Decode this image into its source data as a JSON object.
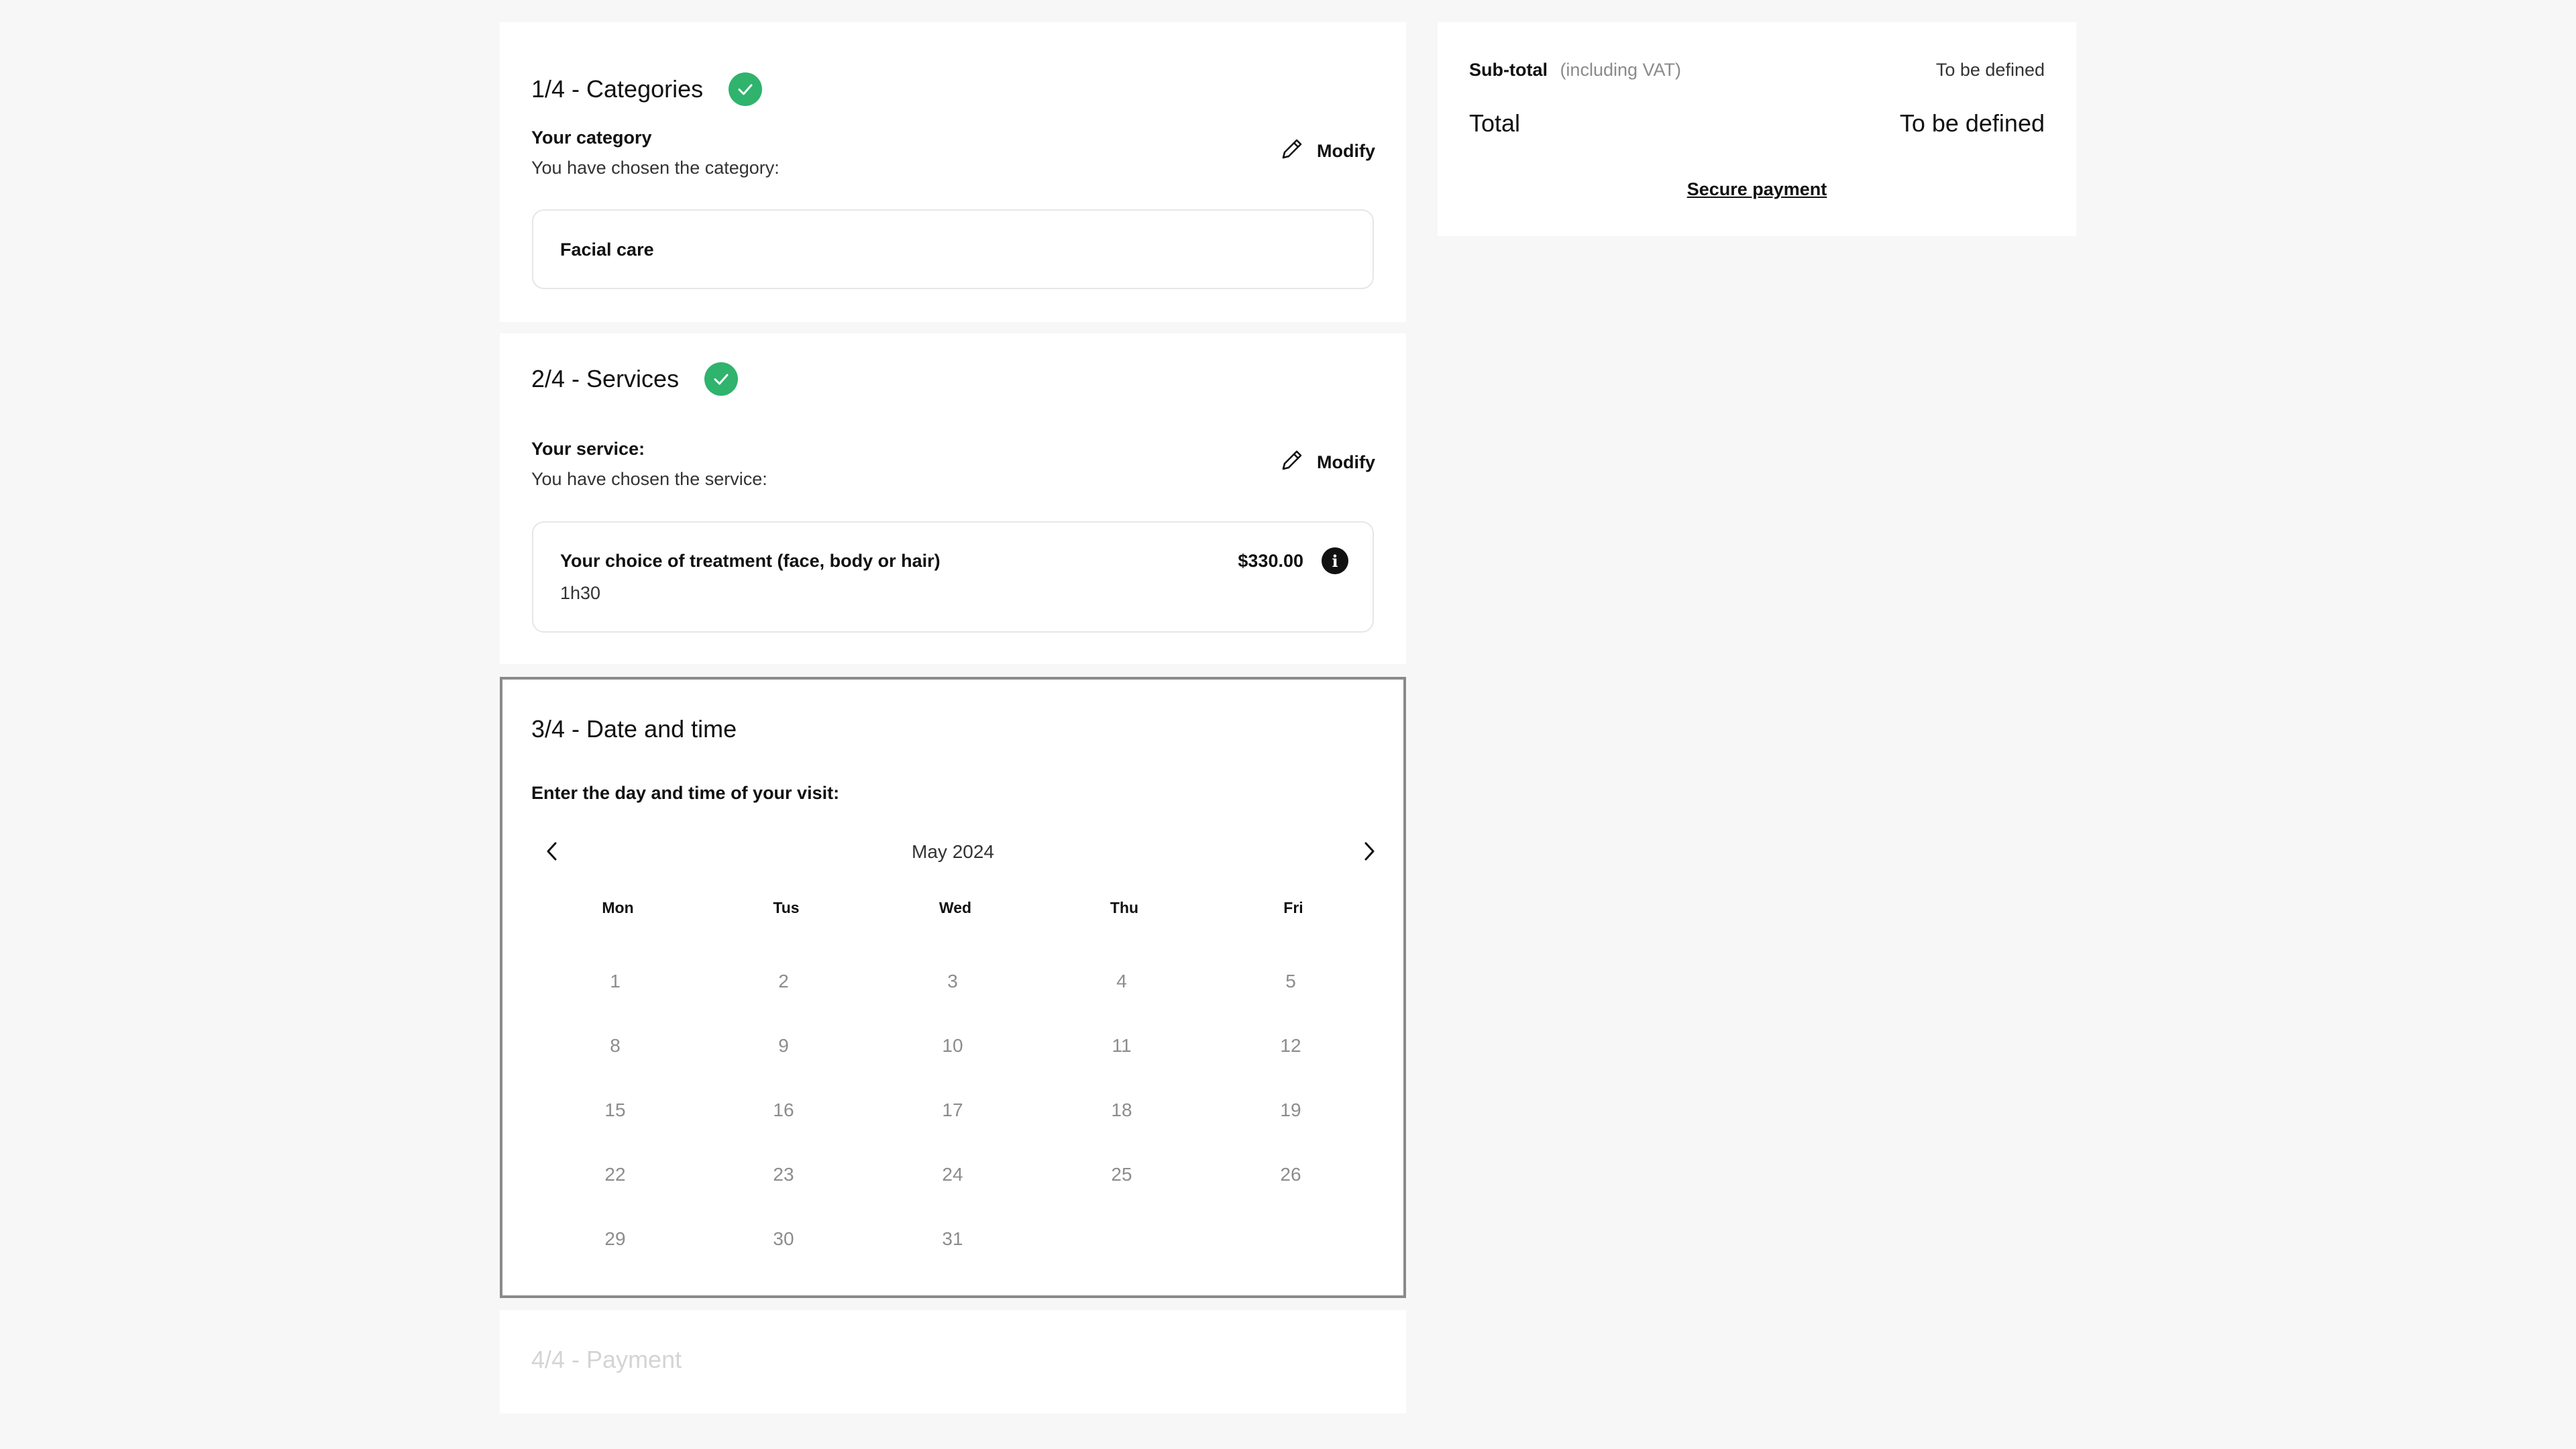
{
  "steps": {
    "categories": {
      "title": "1/4 - Categories",
      "subhead": "Your category",
      "subtext": "You have chosen the category:",
      "modify_label": "Modify",
      "selection": "Facial care"
    },
    "services": {
      "title": "2/4 - Services",
      "subhead": "Your service:",
      "subtext": "You have chosen the service:",
      "modify_label": "Modify",
      "selection": {
        "name": "Your choice of treatment (face, body or hair)",
        "duration": "1h30",
        "price": "$330.00"
      }
    },
    "datetime": {
      "title": "3/4 - Date and time",
      "instruction": "Enter the day and time of your visit:",
      "calendar": {
        "month": "May 2024",
        "weekdays": [
          "Mon",
          "Tus",
          "Wed",
          "Thu",
          "Fri"
        ],
        "weeks": [
          [
            "1",
            "2",
            "3",
            "4",
            "5"
          ],
          [
            "8",
            "9",
            "10",
            "11",
            "12"
          ],
          [
            "15",
            "16",
            "17",
            "18",
            "19"
          ],
          [
            "22",
            "23",
            "24",
            "25",
            "26"
          ],
          [
            "29",
            "30",
            "31",
            "",
            ""
          ]
        ]
      }
    },
    "payment": {
      "title": "4/4 - Payment"
    }
  },
  "summary": {
    "subtotal_label": "Sub-total",
    "subtotal_note": "(including VAT)",
    "subtotal_value": "To be defined",
    "total_label": "Total",
    "total_value": "To be defined",
    "secure_payment": "Secure payment"
  },
  "colors": {
    "check_green": "#2fb36d",
    "page_background": "#f7f7f7",
    "disabled_text": "#d4d4d4"
  }
}
